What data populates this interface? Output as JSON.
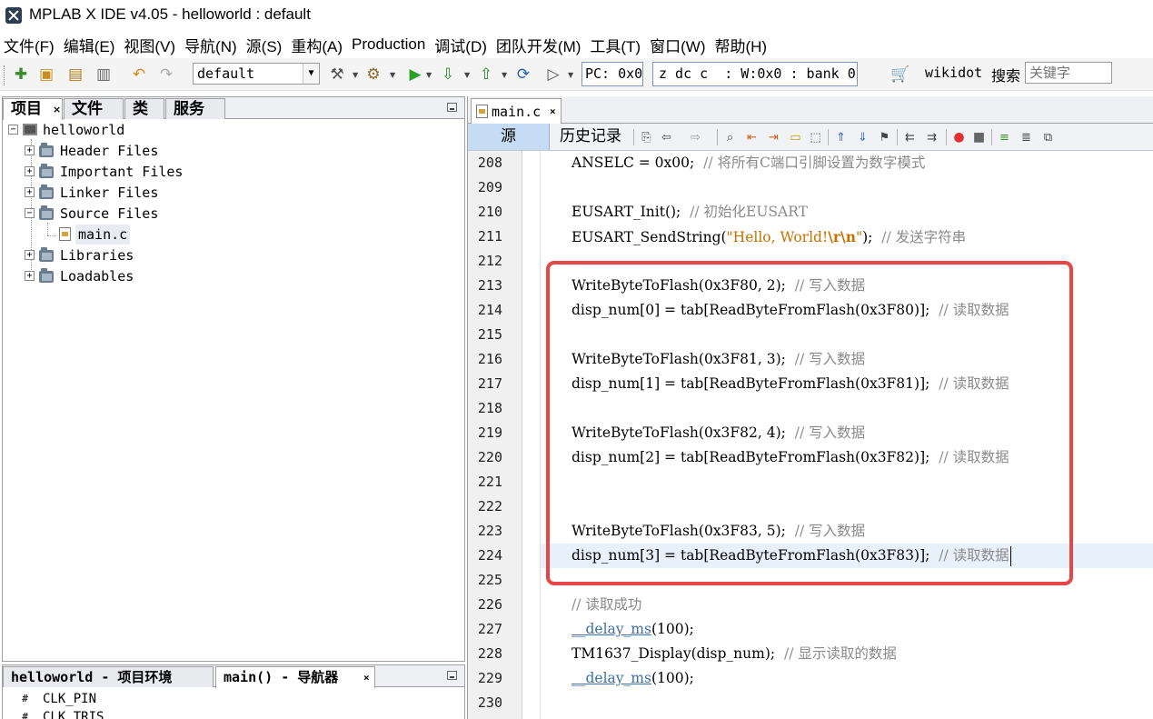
{
  "window": {
    "title": "MPLAB X IDE v4.05 - helloworld : default"
  },
  "menubar": {
    "items": [
      "文件(F)",
      "编辑(E)",
      "视图(V)",
      "导航(N)",
      "源(S)",
      "重构(A)",
      "Production",
      "调试(D)",
      "团队开发(M)",
      "工具(T)",
      "窗口(W)",
      "帮助(H)"
    ]
  },
  "toolbar": {
    "config_value": "default",
    "pc_value": "PC: 0x0",
    "status_value": "z dc c  : W:0x0 : bank 0",
    "wikidot_label": "wikidot",
    "search_label": "搜索",
    "search_placeholder": "关键字"
  },
  "left_panel": {
    "tabs": [
      "项目",
      "文件",
      "类",
      "服务"
    ],
    "tree": {
      "root": "helloworld",
      "folders": [
        "Header Files",
        "Important Files",
        "Linker Files",
        "Source Files",
        "Libraries",
        "Loadables"
      ],
      "source_file": "main.c"
    }
  },
  "nav_panel": {
    "tabs": [
      "helloworld - 项目环境",
      "main() - 导航器"
    ],
    "items": [
      "CLK_PIN",
      "CLK_TRIS"
    ]
  },
  "editor": {
    "file_tab": "main.c",
    "view_source": "源",
    "view_history": "历史记录",
    "lines": [
      {
        "num": "208",
        "segs": [
          [
            "t",
            "ANSELC = 0x00;  "
          ],
          [
            "c",
            "// 将所有C端口引脚设置为数字模式"
          ]
        ]
      },
      {
        "num": "209",
        "segs": []
      },
      {
        "num": "210",
        "segs": [
          [
            "t",
            "EUSART_Init();  "
          ],
          [
            "c",
            "// 初始化EUSART"
          ]
        ]
      },
      {
        "num": "211",
        "segs": [
          [
            "t",
            "EUSART_SendString("
          ],
          [
            "s",
            "\"Hello, World!"
          ],
          [
            "e",
            "\\r\\n"
          ],
          [
            "s",
            "\""
          ],
          [
            "t",
            ");  "
          ],
          [
            "c",
            "// 发送字符串"
          ]
        ]
      },
      {
        "num": "212",
        "segs": []
      },
      {
        "num": "213",
        "segs": [
          [
            "t",
            "WriteByteToFlash(0x3F80, 2);  "
          ],
          [
            "c",
            "// 写入数据"
          ]
        ]
      },
      {
        "num": "214",
        "segs": [
          [
            "t",
            "disp_num[0] = tab[ReadByteFromFlash(0x3F80)];  "
          ],
          [
            "c",
            "// 读取数据"
          ]
        ]
      },
      {
        "num": "215",
        "segs": []
      },
      {
        "num": "216",
        "segs": [
          [
            "t",
            "WriteByteToFlash(0x3F81, 3);  "
          ],
          [
            "c",
            "// 写入数据"
          ]
        ]
      },
      {
        "num": "217",
        "segs": [
          [
            "t",
            "disp_num[1] = tab[ReadByteFromFlash(0x3F81)];  "
          ],
          [
            "c",
            "// 读取数据"
          ]
        ]
      },
      {
        "num": "218",
        "segs": []
      },
      {
        "num": "219",
        "segs": [
          [
            "t",
            "WriteByteToFlash(0x3F82, 4);  "
          ],
          [
            "c",
            "// 写入数据"
          ]
        ]
      },
      {
        "num": "220",
        "segs": [
          [
            "t",
            "disp_num[2] = tab[ReadByteFromFlash(0x3F82)];  "
          ],
          [
            "c",
            "// 读取数据"
          ]
        ]
      },
      {
        "num": "221",
        "segs": []
      },
      {
        "num": "222",
        "segs": []
      },
      {
        "num": "223",
        "segs": [
          [
            "t",
            "WriteByteToFlash(0x3F83, 5);  "
          ],
          [
            "c",
            "// 写入数据"
          ]
        ]
      },
      {
        "num": "224",
        "segs": [
          [
            "t",
            "disp_num[3] = tab[ReadByteFromFlash(0x3F83)];  "
          ],
          [
            "c",
            "// 读取数据"
          ]
        ]
      },
      {
        "num": "225",
        "segs": []
      },
      {
        "num": "226",
        "segs": [
          [
            "c",
            "// 读取成功"
          ]
        ]
      },
      {
        "num": "227",
        "segs": [
          [
            "m",
            "__delay_ms"
          ],
          [
            "t",
            "(100);"
          ]
        ]
      },
      {
        "num": "228",
        "segs": [
          [
            "t",
            "TM1637_Display(disp_num);  "
          ],
          [
            "c",
            "// 显示读取的数据"
          ]
        ]
      },
      {
        "num": "229",
        "segs": [
          [
            "m",
            "__delay_ms"
          ],
          [
            "t",
            "(100);"
          ]
        ]
      },
      {
        "num": "230",
        "segs": []
      }
    ],
    "current_line_index": 16
  },
  "colors": {
    "highlight_box": "#e64746",
    "comment": "#8a8a8a",
    "string": "#c96f00",
    "macro": "#3e6fa8",
    "current_line": "#e8f0fc"
  }
}
